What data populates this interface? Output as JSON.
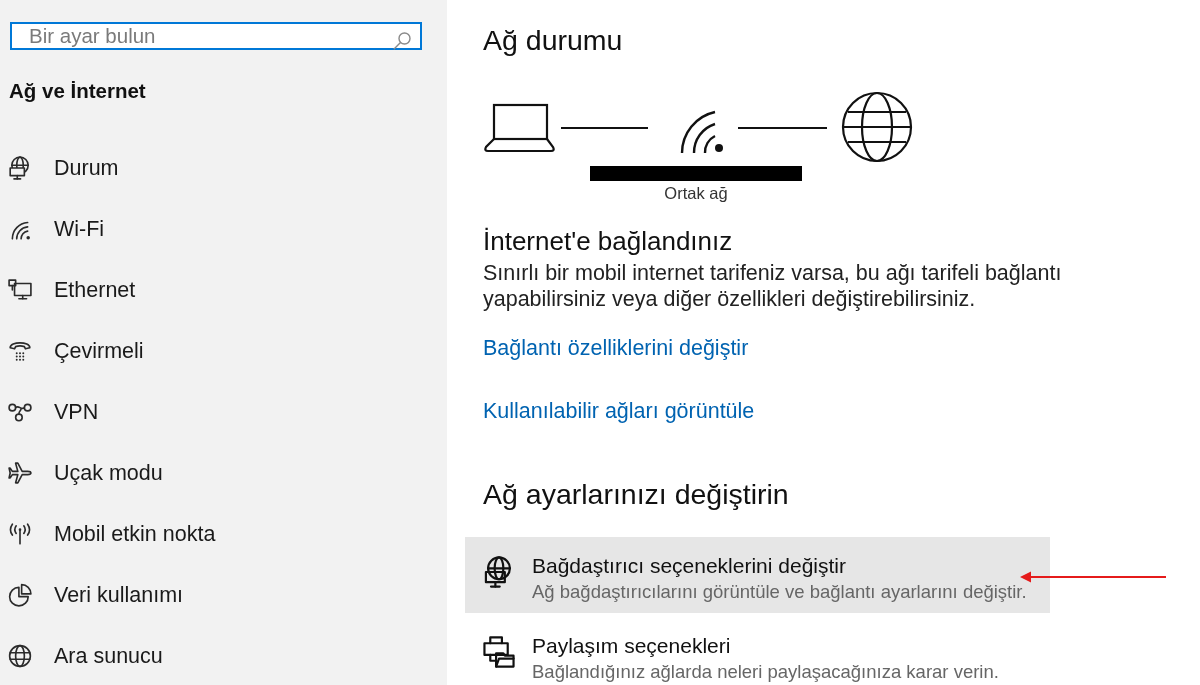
{
  "sidebar": {
    "search": {
      "placeholder": "Bir ayar bulun"
    },
    "title": "Ağ ve İnternet",
    "items": [
      {
        "label": "Durum"
      },
      {
        "label": "Wi-Fi"
      },
      {
        "label": "Ethernet"
      },
      {
        "label": "Çevirmeli"
      },
      {
        "label": "VPN"
      },
      {
        "label": "Uçak modu"
      },
      {
        "label": "Mobil etkin nokta"
      },
      {
        "label": "Veri kullanımı"
      },
      {
        "label": "Ara sunucu"
      }
    ]
  },
  "main": {
    "network_status": {
      "heading": "Ağ durumu",
      "network_label": "Ortak ağ"
    },
    "connection": {
      "title": "İnternet'e bağlandınız",
      "description": "Sınırlı bir mobil internet tarifeniz varsa, bu ağı tarifeli bağlantı yapabilirsiniz veya diğer özellikleri değiştirebilirsiniz.",
      "links": [
        "Bağlantı özelliklerini değiştir",
        "Kullanılabilir ağları görüntüle"
      ]
    },
    "change_settings": {
      "heading": "Ağ ayarlarınızı değiştirin",
      "items": [
        {
          "title": "Bağdaştırıcı seçeneklerini değiştir",
          "description": "Ağ bağdaştırıcılarını görüntüle ve bağlantı ayarlarını değiştir.",
          "selected": true
        },
        {
          "title": "Paylaşım seçenekleri",
          "description": "Bağlandığınız ağlarda neleri paylaşacağınıza karar verin.",
          "selected": false
        }
      ]
    }
  }
}
